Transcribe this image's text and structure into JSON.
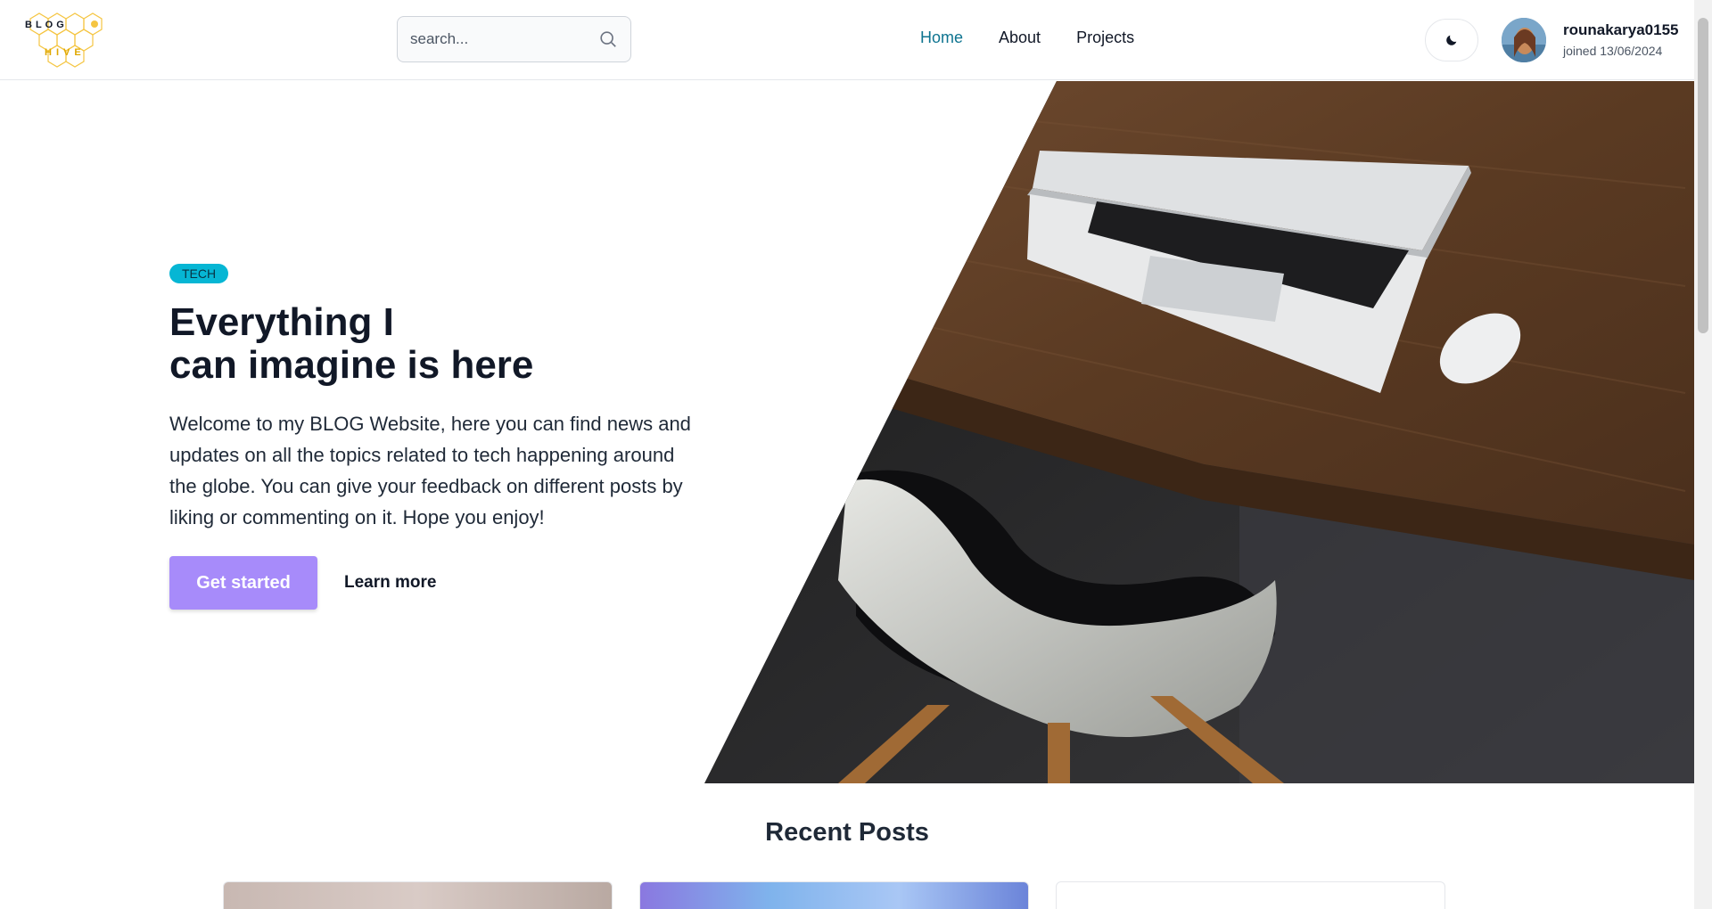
{
  "header": {
    "logo_top": "BLOG",
    "logo_bottom": "HIVE",
    "search_placeholder": "search...",
    "nav": [
      {
        "label": "Home",
        "active": true
      },
      {
        "label": "About",
        "active": false
      },
      {
        "label": "Projects",
        "active": false
      }
    ],
    "theme_icon": "moon-icon",
    "user": {
      "name": "rounakarya0155",
      "joined": "joined 13/06/2024"
    }
  },
  "hero": {
    "badge": "TECH",
    "title_line1": "Everything I",
    "title_line2": "can imagine is here",
    "description": "Welcome to my BLOG Website, here you can find news and updates on all the topics related to tech happening around the globe. You can give your feedback on different posts by liking or commenting on it. Hope you enjoy!",
    "primary_button": "Get started",
    "secondary_button": "Learn more"
  },
  "recent": {
    "title": "Recent Posts"
  },
  "colors": {
    "accent": "#a78bfa",
    "badge": "#06b6d4",
    "nav_active": "#0e7490"
  }
}
